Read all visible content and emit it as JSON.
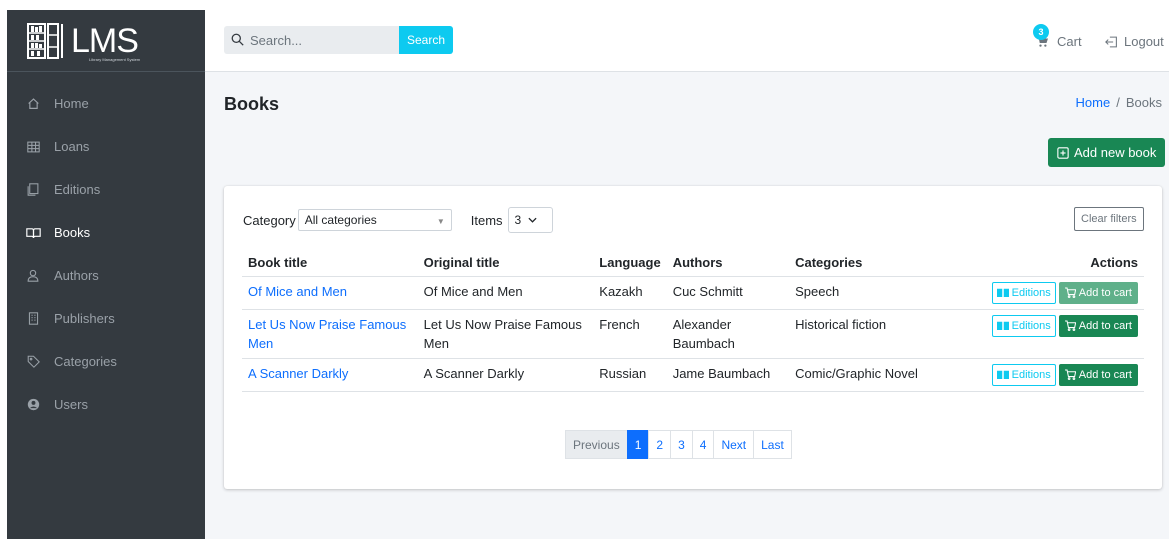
{
  "sidebar": {
    "logo": {
      "text": "LMS",
      "subtitle": "Library Management System"
    },
    "items": [
      {
        "label": "Home",
        "icon": "home-icon"
      },
      {
        "label": "Loans",
        "icon": "table-icon"
      },
      {
        "label": "Editions",
        "icon": "copy-icon"
      },
      {
        "label": "Books",
        "icon": "book-icon",
        "active": true
      },
      {
        "label": "Authors",
        "icon": "user-icon"
      },
      {
        "label": "Publishers",
        "icon": "building-icon"
      },
      {
        "label": "Categories",
        "icon": "tag-icon"
      },
      {
        "label": "Users",
        "icon": "user-circle-icon"
      }
    ]
  },
  "header": {
    "search": {
      "placeholder": "Search...",
      "button_label": "Search"
    },
    "cart": {
      "label": "Cart",
      "count": "3"
    },
    "logout_label": "Logout"
  },
  "main": {
    "title": "Books",
    "breadcrumb": [
      "Home",
      "Books"
    ],
    "add_button_label": "Add new book",
    "filters": {
      "category_label": "Category",
      "category_value": "All categories",
      "items_label": "Items",
      "items_value": "3",
      "clear_label": "Clear filters"
    },
    "table": {
      "headers": [
        "Book title",
        "Original title",
        "Language",
        "Authors",
        "Categories",
        "Actions"
      ],
      "rows": [
        {
          "title": "Of Mice and Men",
          "original": "Of Mice and Men",
          "language": "Kazakh",
          "authors": "Cuc Schmitt",
          "categories": "Speech",
          "cart_disabled": true
        },
        {
          "title": "Let Us Now Praise Famous Men",
          "original": "Let Us Now Praise Famous Men",
          "language": "French",
          "authors": "Alexander Baumbach",
          "categories": "Historical fiction",
          "cart_disabled": false
        },
        {
          "title": "A Scanner Darkly",
          "original": "A Scanner Darkly",
          "language": "Russian",
          "authors": "Jame Baumbach",
          "categories": "Comic/Graphic Novel",
          "cart_disabled": false
        }
      ],
      "editions_label": "Editions",
      "add_to_cart_label": "Add to cart"
    },
    "pagination": {
      "previous": "Previous",
      "pages": [
        "1",
        "2",
        "3",
        "4"
      ],
      "next": "Next",
      "last": "Last",
      "current": "1"
    }
  },
  "colors": {
    "sidebar_bg": "#343a40",
    "primary": "#0d6efd",
    "info": "#0dcaf0",
    "success": "#198754"
  }
}
